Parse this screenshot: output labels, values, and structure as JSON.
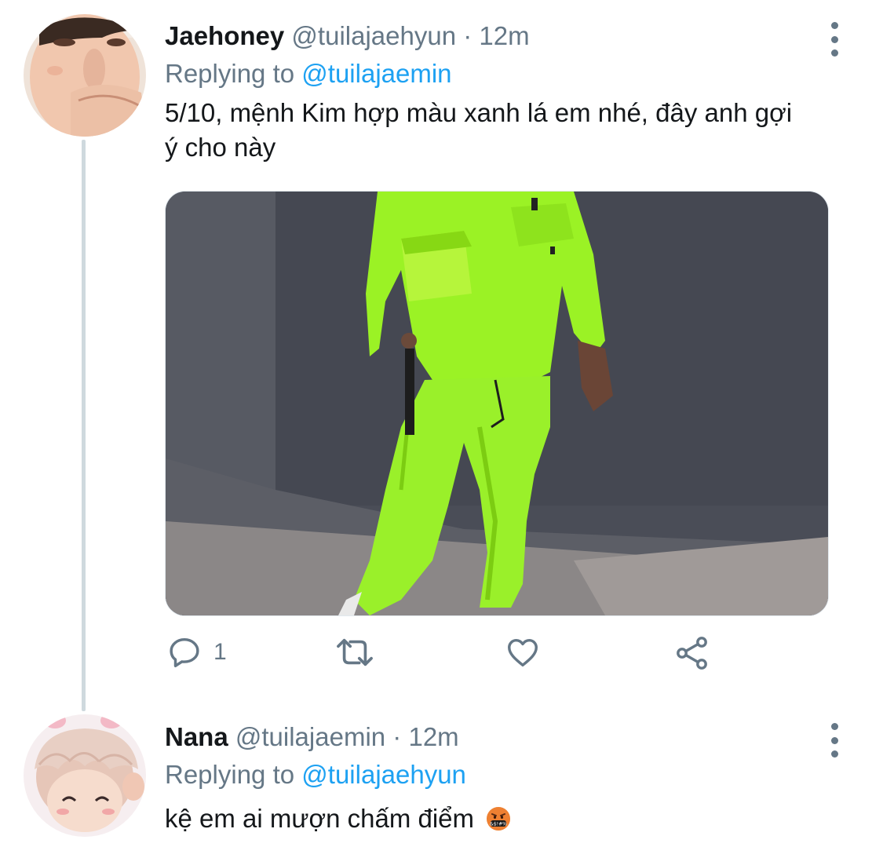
{
  "tweets": [
    {
      "display_name": "Jaehoney",
      "handle": "@tuilajaehyun",
      "separator": "·",
      "time": "12m",
      "replying_prefix": "Replying to",
      "replying_to": "@tuilajaemin",
      "text_line1": "5/10, mệnh Kim hợp màu xanh lá em nhé, đây anh gợi",
      "text_line2": "ý cho này",
      "reply_count": "1",
      "icons": [
        "more-vertical-icon",
        "reply-icon",
        "retweet-icon",
        "like-icon",
        "share-icon"
      ]
    },
    {
      "display_name": "Nana",
      "handle": "@tuilajaemin",
      "separator": "·",
      "time": "12m",
      "replying_prefix": "Replying to",
      "replying_to": "@tuilajaehyun",
      "text": "kệ em ai mượn chấm điểm",
      "emoji": "face-with-symbols-on-mouth-emoji",
      "icons": [
        "more-vertical-icon"
      ]
    }
  ],
  "colors": {
    "accent": "#1da1f2",
    "secondary_text": "#657786",
    "thread_line": "#cfd9de"
  }
}
